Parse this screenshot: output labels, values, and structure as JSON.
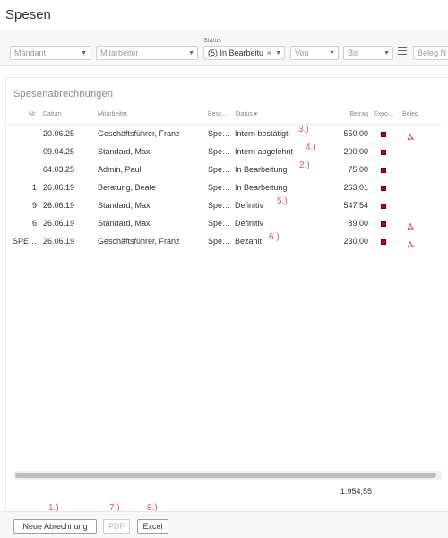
{
  "title": "Spesen",
  "filters": {
    "mandant": "Mandant",
    "mitarbeiter": "Mitarbeiter",
    "status_label": "Status",
    "status_value": "(5) In Bearbeitu",
    "von": "Von",
    "bis": "Bis",
    "beleg": "Beleg N"
  },
  "panel_title": "Spesenabrechnungen",
  "columns": {
    "nr": "Nr.",
    "datum": "Datum",
    "mitarbeiter": "Mitarbeiter",
    "besc": "Besc…",
    "status": "Status ▾",
    "betrag": "Betrag",
    "expo": "Expo…",
    "beleg": "Beleg"
  },
  "rows": [
    {
      "nr": "",
      "datum": "20.06.25",
      "mitarbeiter": "Geschäftsführer, Franz",
      "besc": "Spe…",
      "status": "Intern bestätigt",
      "betrag": "550,00",
      "exported": true,
      "pdf": true
    },
    {
      "nr": "",
      "datum": "09.04.25",
      "mitarbeiter": "Standard, Max",
      "besc": "Spe…",
      "status": "Intern abgelehnt",
      "betrag": "200,00",
      "exported": true,
      "pdf": false
    },
    {
      "nr": "",
      "datum": "04.03.25",
      "mitarbeiter": "Admin, Paul",
      "besc": "Spe…",
      "status": "In Bearbeitung",
      "betrag": "75,00",
      "exported": true,
      "pdf": false
    },
    {
      "nr": "1",
      "datum": "26.06.19",
      "mitarbeiter": "Beratung, Beate",
      "besc": "Spe…",
      "status": "In Bearbeitung",
      "betrag": "263,01",
      "exported": true,
      "pdf": false
    },
    {
      "nr": "9",
      "datum": "26.06.19",
      "mitarbeiter": "Standard, Max",
      "besc": "Spe…",
      "status": "Definitiv",
      "betrag": "547,54",
      "exported": true,
      "pdf": false
    },
    {
      "nr": "6",
      "datum": "26.06.19",
      "mitarbeiter": "Standard, Max",
      "besc": "Spe…",
      "status": "Definitiv",
      "betrag": "89,00",
      "exported": true,
      "pdf": true
    },
    {
      "nr": "SPE…",
      "datum": "26.06.19",
      "mitarbeiter": "Geschäftsführer, Franz",
      "besc": "Spe…",
      "status": "Bezahlt",
      "betrag": "230,00",
      "exported": true,
      "pdf": true
    }
  ],
  "annotations": {
    "a3": "3.)",
    "a4": "4.)",
    "a2": "2.)",
    "a5": "5.)",
    "a6": "6.)",
    "a1": "1.)",
    "a7": "7.)",
    "a8": "8.)"
  },
  "total": "1.954,55",
  "buttons": {
    "new": "Neue Abrechnung",
    "pdf": "PDF",
    "excel": "Excel"
  },
  "colors": {
    "export_marker": "#c8000a",
    "annotation": "#e0508a"
  }
}
